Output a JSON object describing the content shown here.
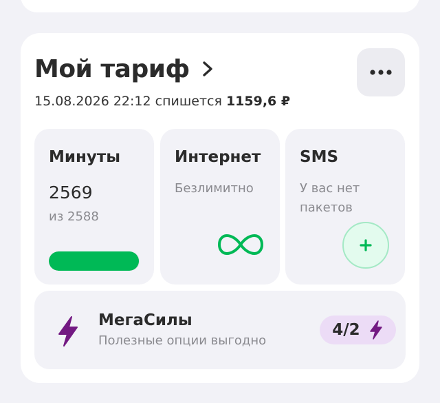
{
  "colors": {
    "brand_green": "#00b956",
    "brand_purple": "#731982",
    "badge_bg": "#ecdcf6",
    "tile_bg": "#f2f2f7"
  },
  "header": {
    "title": "Мой тариф",
    "chevron_icon": "chevron-right-icon",
    "more_icon": "more-dots-icon"
  },
  "charge": {
    "date": "15.08.2026",
    "time": "22:12",
    "action": "спишется",
    "amount": "1159,6 ₽"
  },
  "tiles": {
    "minutes": {
      "title": "Минуты",
      "value": "2569",
      "total": "из 2588",
      "progress": 0.993
    },
    "internet": {
      "title": "Интернет",
      "desc": "Безлимитно",
      "icon": "infinity-icon"
    },
    "sms": {
      "title": "SMS",
      "desc": "У вас нет пакетов",
      "icon": "plus-icon"
    }
  },
  "megasily": {
    "title": "МегаСилы",
    "subtitle": "Полезные опции выгодно",
    "badge": "4/2",
    "icon": "lightning-icon"
  }
}
